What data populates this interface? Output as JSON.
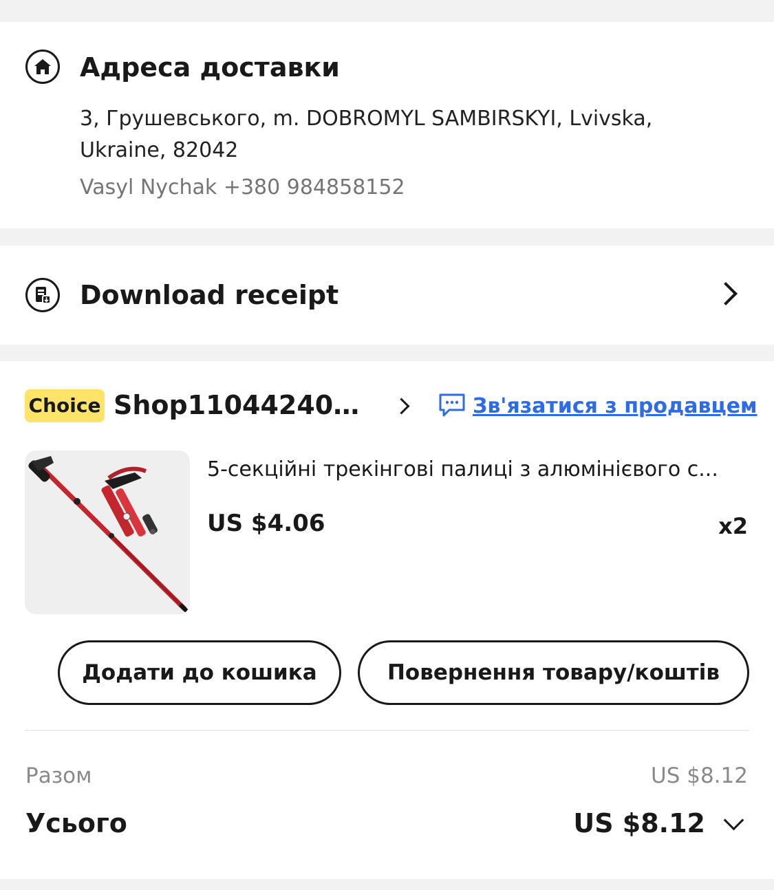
{
  "address": {
    "title": "Адреса доставки",
    "line": "3, Грушевського, m. DOBROMYL SAMBIRSKYI, Lvivska, Ukraine, 82042",
    "recipient": "Vasyl Nychak +380 984858152",
    "icon": "home-icon"
  },
  "receipt": {
    "title": "Download receipt",
    "icon": "receipt-icon"
  },
  "order": {
    "badge": "Choice",
    "shop_name": "Shop110442407...",
    "contact_label": "Зв'язатися з продавцем",
    "product": {
      "title": "5-секційні трекінгові палиці з алюмінієвого с...",
      "price": "US $4.06",
      "quantity": "x2"
    },
    "buttons": {
      "add_to_cart": "Додати до кошика",
      "return": "Повернення товару/коштів"
    },
    "subtotal_label": "Разом",
    "subtotal_value": "US $8.12",
    "total_label": "Усього",
    "total_value": "US $8.12"
  },
  "colors": {
    "accent_link": "#2e6be6",
    "badge_yellow": "#fde468",
    "background": "#f2f2f2",
    "product_red": "#c4262e"
  }
}
